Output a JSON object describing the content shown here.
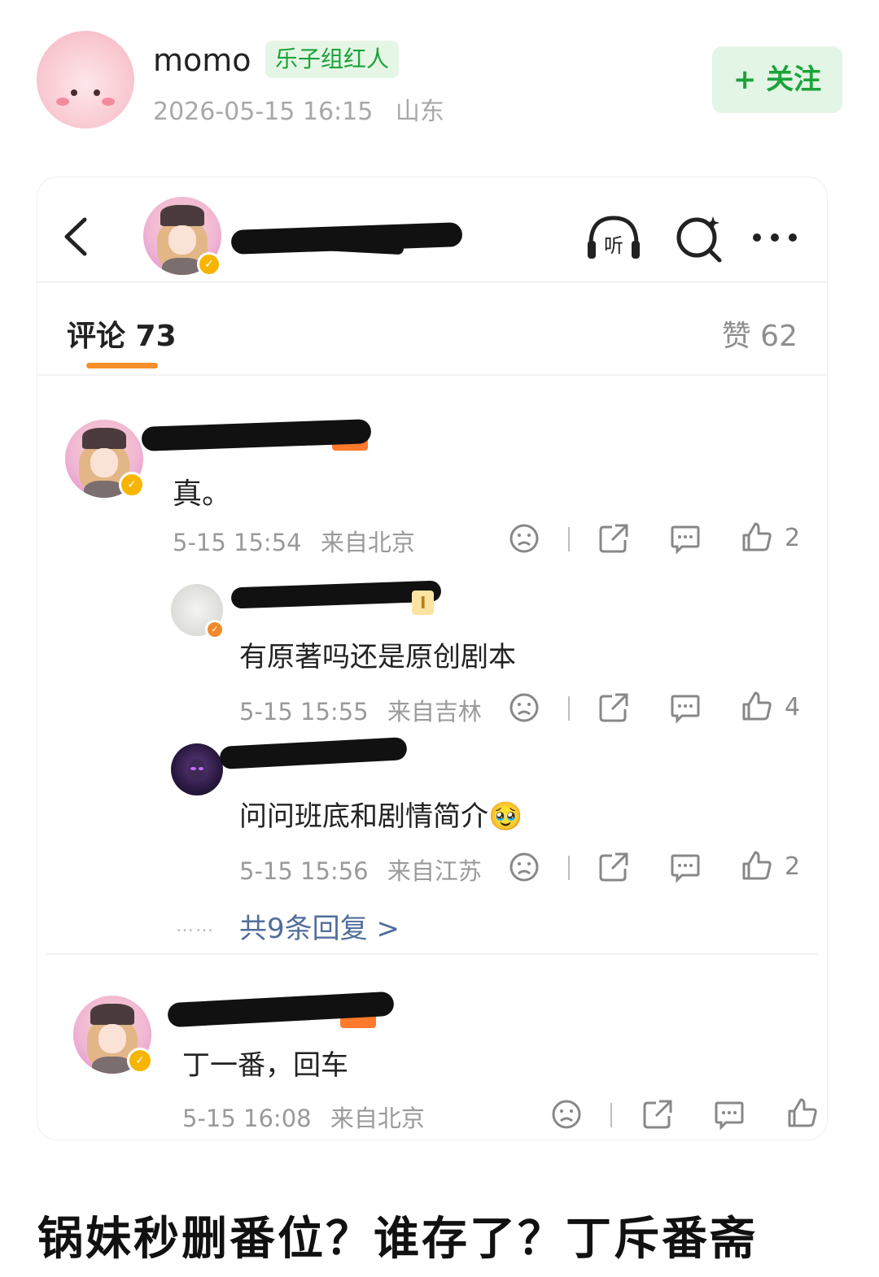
{
  "post": {
    "author_name": "momo",
    "author_badge": "乐子组红人",
    "timestamp": "2026-05-15 16:15",
    "location": "山东",
    "follow_label": "+ 关注"
  },
  "card": {
    "tabs": {
      "comments_label": "评论 73",
      "likes_label": "赞 62"
    },
    "comments": [
      {
        "text": "真。",
        "date": "5-15 15:54",
        "from": "来自北京",
        "likes": "2"
      },
      {
        "text": "丁一番，回车",
        "date": "5-15 16:08",
        "from": "来自北京",
        "likes": ""
      }
    ],
    "replies": [
      {
        "text": "有原著吗还是原创剧本",
        "date": "5-15 15:55",
        "from": "来自吉林",
        "likes": "4",
        "level": "I"
      },
      {
        "text": "问问班底和剧情简介🥹",
        "date": "5-15 15:56",
        "from": "来自江苏",
        "likes": "2"
      }
    ],
    "more_replies_label": "共9条回复 >",
    "listen_icon_label": "听"
  },
  "bottom_title": "锅妹秒删番位？谁存了？丁斥番斋",
  "colors": {
    "follow_green": "#1ca33a",
    "tab_underline_orange": "#f7902a",
    "link_blue": "#516e9b",
    "verified_gold": "#f7b500"
  },
  "icons": [
    "back-icon",
    "listen-icon",
    "search-icon",
    "more-icon",
    "dislike-icon",
    "share-icon",
    "comment-icon",
    "like-icon"
  ]
}
